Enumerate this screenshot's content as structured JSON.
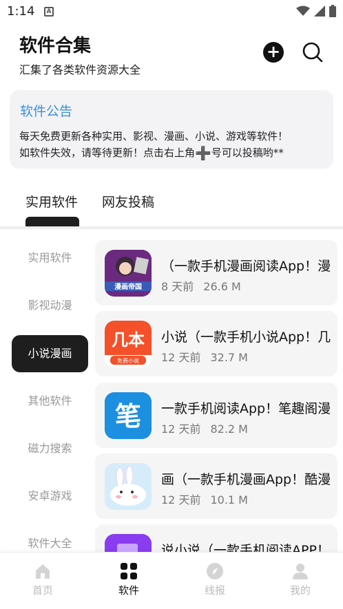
{
  "status_bar": {
    "time": "1:14",
    "notification_icon": "a-icon",
    "indicators": [
      "wifi-icon",
      "signal-icon",
      "battery-icon"
    ]
  },
  "header": {
    "title": "软件合集",
    "subtitle": "汇集了各类软件资源大全",
    "add_icon": "plus-circle-icon",
    "search_icon": "search-icon"
  },
  "notice": {
    "title": "软件公告",
    "line1": "每天免费更新各种实用、影视、漫画、小说、游戏等软件！",
    "line2_a": "如软件失效，请等待更新！点击右上角",
    "line2_plus": "➕",
    "line2_b": "号可以投稿哟**"
  },
  "tabs": [
    {
      "label": "实用软件",
      "active": true
    },
    {
      "label": "网友投稿",
      "active": false
    }
  ],
  "categories": [
    {
      "label": "实用软件",
      "active": false
    },
    {
      "label": "影视动漫",
      "active": false
    },
    {
      "label": "小说漫画",
      "active": true
    },
    {
      "label": "其他软件",
      "active": false
    },
    {
      "label": "磁力搜索",
      "active": false
    },
    {
      "label": "安卓游戏",
      "active": false
    },
    {
      "label": "软件大全",
      "active": false
    }
  ],
  "apps": [
    {
      "name": "（一款手机漫画阅读App！漫",
      "age": "8 天前",
      "size": "26.6 M",
      "icon": "manhua-diguo-icon",
      "icon_text": "漫画帝国"
    },
    {
      "name": "小说（一款手机小说App！几",
      "age": "12 天前",
      "size": "32.7 M",
      "icon": "jiben-novel-icon",
      "icon_text": "几本",
      "icon_sub": "免费小说"
    },
    {
      "name": "一款手机阅读App！笔趣阁漫",
      "age": "12 天前",
      "size": "82.2 M",
      "icon": "biquge-icon",
      "icon_text": "笔"
    },
    {
      "name": "画（一款手机漫画App！酷漫",
      "age": "12 天前",
      "size": "10.1 M",
      "icon": "bunny-icon"
    },
    {
      "name": "说小说（一款手机阅读APP！",
      "age": "",
      "size": "",
      "icon": "purple-book-icon"
    }
  ],
  "bottom_nav": [
    {
      "label": "首页",
      "icon": "home-icon",
      "active": false
    },
    {
      "label": "软件",
      "icon": "grid-icon",
      "active": true
    },
    {
      "label": "线报",
      "icon": "compass-icon",
      "active": false
    },
    {
      "label": "我的",
      "icon": "user-icon",
      "active": false
    }
  ],
  "colors": {
    "accent_blue": "#3a8fd8",
    "dark": "#1e1e1e",
    "muted": "#999999",
    "card_bg": "#f5f5f6"
  }
}
